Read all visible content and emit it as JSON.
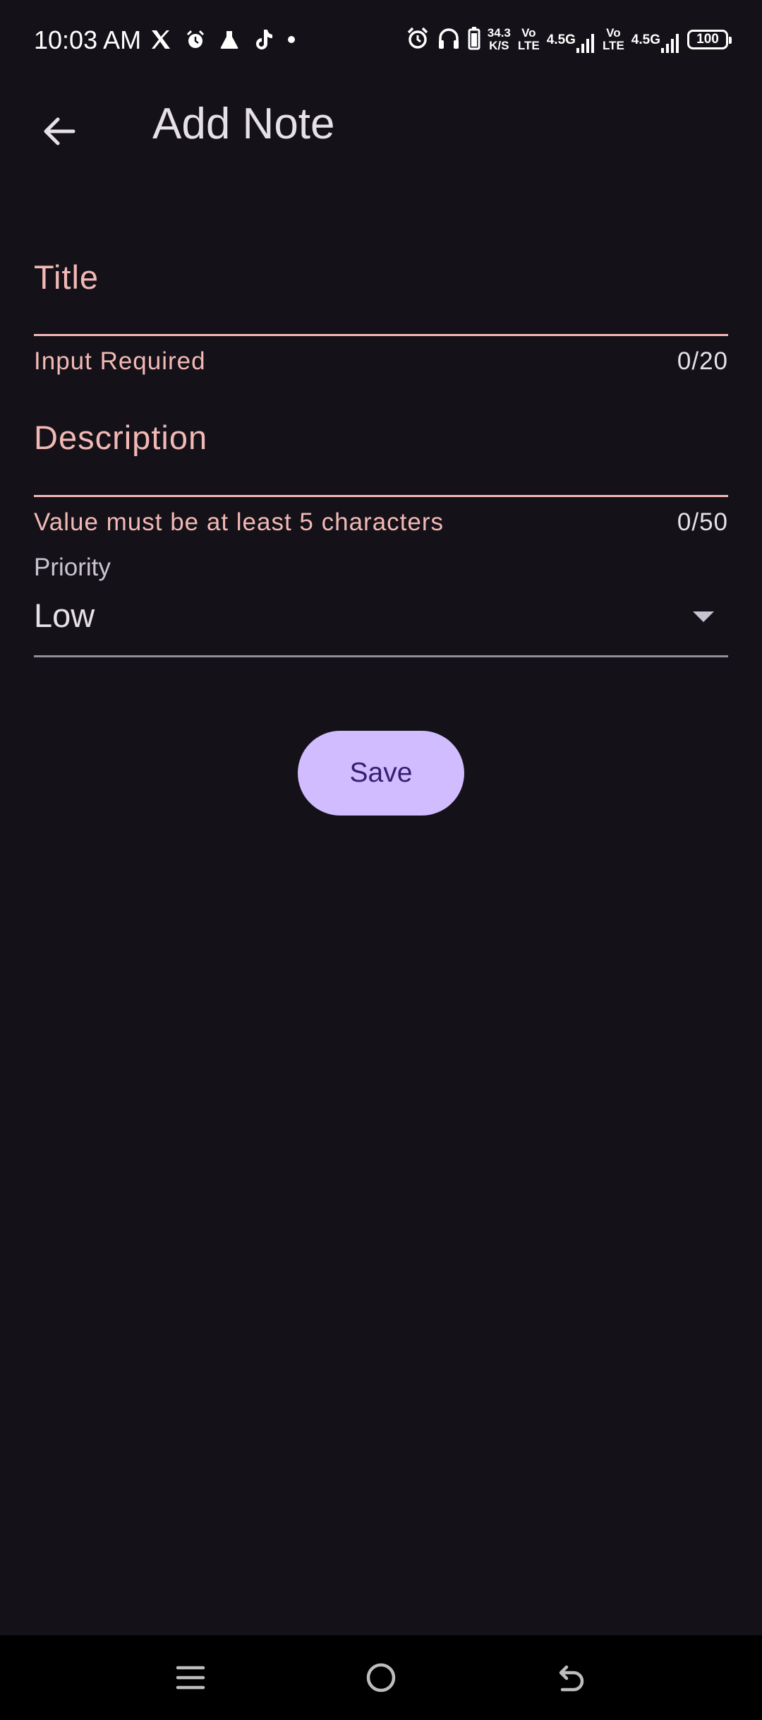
{
  "status_bar": {
    "time": "10:03 AM",
    "left_icons": [
      "x-logo-icon",
      "alarm-clock-icon",
      "flask-icon",
      "tiktok-icon",
      "dot-icon"
    ],
    "network_speed_value": "34.3",
    "network_speed_unit": "K/S",
    "sim1_volte_top": "Vo",
    "sim1_volte_bottom": "LTE",
    "sim1_network": "4.5G",
    "sim2_volte_top": "Vo",
    "sim2_volte_bottom": "LTE",
    "sim2_network": "4.5G",
    "battery_level": "100",
    "right_icons": [
      "alarm-icon",
      "headphones-icon",
      "battery-saver-icon",
      "signal-icon",
      "battery-icon"
    ]
  },
  "app_bar": {
    "title": "Add Note",
    "back_icon": "arrow-back-icon"
  },
  "form": {
    "title_field": {
      "label": "Title",
      "helper": "Input Required",
      "counter": "0/20"
    },
    "description_field": {
      "label": "Description",
      "helper": "Value must be at least 5 characters",
      "counter": "0/50"
    },
    "priority": {
      "label": "Priority",
      "selected": "Low"
    },
    "save_label": "Save"
  },
  "nav_bar": {
    "icons": [
      "menu-icon",
      "home-icon",
      "back-icon"
    ]
  },
  "colors": {
    "background": "#141218",
    "error": "#F2B8B5",
    "primary_container": "#D0BCFF",
    "on_primary": "#381E72",
    "on_surface": "#E6E0E9"
  }
}
